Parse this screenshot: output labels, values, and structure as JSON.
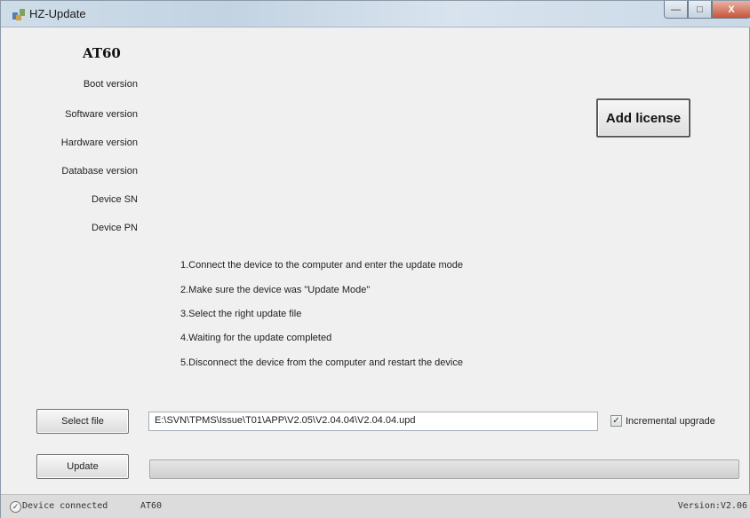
{
  "window": {
    "title": "HZ-Update",
    "minimize_glyph": "—",
    "maximize_glyph": "□",
    "close_glyph": "X"
  },
  "device": {
    "model": "AT60"
  },
  "info_labels": {
    "boot": "Boot   version",
    "software": "Software version",
    "hardware": "Hardware version",
    "database": "Database version",
    "sn": "Device SN",
    "pn": "Device PN"
  },
  "buttons": {
    "add_license": "Add license",
    "select_file": "Select file",
    "update": "Update"
  },
  "instructions": [
    "1.Connect the device to the computer and enter the update mode",
    "2.Make sure the device was \"Update Mode\"",
    "3.Select the right update file",
    "4.Waiting for the update completed",
    "5.Disconnect the device from the computer and restart the device"
  ],
  "file": {
    "path": "E:\\SVN\\TPMS\\Issue\\T01\\APP\\V2.05\\V2.04.04\\V2.04.04.upd"
  },
  "incremental": {
    "label": "Incremental upgrade",
    "checked": true,
    "check_glyph": "✓"
  },
  "progress": {
    "value": 0
  },
  "status": {
    "connection_text": "Device connected",
    "device": "AT60",
    "version_text": "Version:V2.06",
    "icon_glyph": "✓"
  }
}
